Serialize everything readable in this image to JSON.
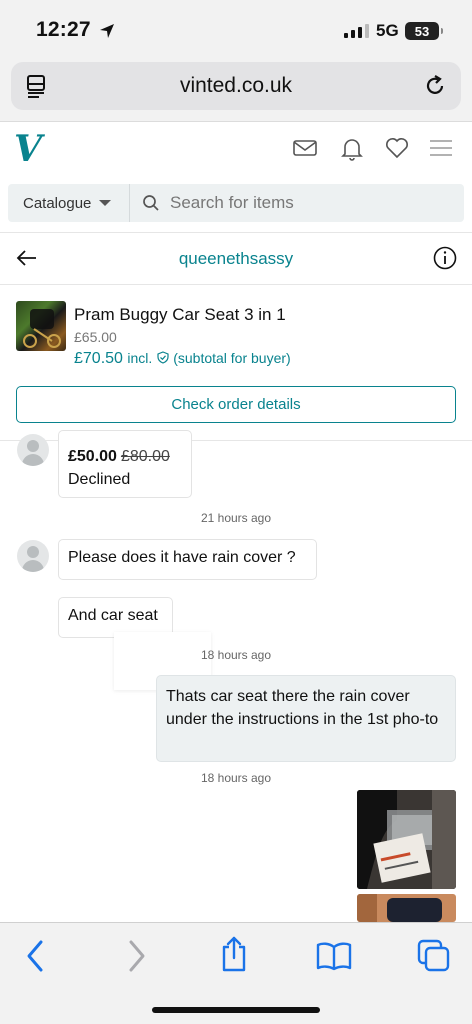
{
  "status_bar": {
    "time": "12:27",
    "network": "5G",
    "battery": "53"
  },
  "browser": {
    "url": "vinted.co.uk"
  },
  "site": {
    "logo": "V",
    "catalogue_label": "Catalogue",
    "search_placeholder": "Search for items"
  },
  "conversation": {
    "username": "queenethsassy",
    "item": {
      "title": "Pram Buggy Car Seat 3 in 1",
      "price": "£65.00",
      "total": "£70.50",
      "total_incl": "incl.",
      "total_note": "(subtotal for buyer)",
      "order_button": "Check order details"
    },
    "messages": {
      "offer_price": "£50.00",
      "offer_original": "£80.00",
      "offer_status": "Declined",
      "ts1": "21 hours ago",
      "msg1": "Please does it have rain cover ?",
      "msg2": "And car seat",
      "ts2": "18 hours ago",
      "reply": "Thats car seat there the rain cover under the instructions in the 1st pho-to",
      "ts3": "18 hours ago"
    }
  },
  "icons": [
    "reader-icon",
    "reload-icon",
    "mail-icon",
    "bell-icon",
    "heart-icon",
    "menu-icon",
    "search-icon",
    "back-arrow-icon",
    "info-icon",
    "back-icon",
    "forward-icon",
    "share-icon",
    "bookmarks-icon",
    "tabs-icon"
  ],
  "colors": {
    "brand": "#09838e",
    "ios_blue": "#1a73e8"
  }
}
